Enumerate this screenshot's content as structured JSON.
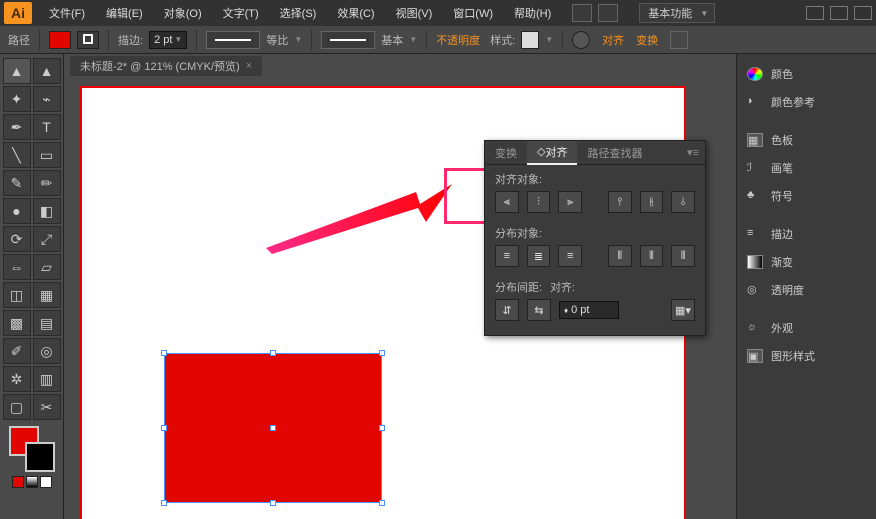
{
  "app": {
    "logo": "Ai"
  },
  "menu": [
    "文件(F)",
    "编辑(E)",
    "对象(O)",
    "文字(T)",
    "选择(S)",
    "效果(C)",
    "视图(V)",
    "窗口(W)",
    "帮助(H)"
  ],
  "top_dropdown": "基本功能",
  "control": {
    "path_label": "路径",
    "fill_color": "#e10600",
    "stroke_color": "#000000",
    "stroke_label": "描边:",
    "stroke_value": "2 pt",
    "profile": "等比",
    "brush": "基本",
    "opacity_label": "不透明度",
    "style_label": "样式:",
    "align_label": "对齐",
    "transform_label": "变换"
  },
  "doc_tab": {
    "title": "未标题-2* @ 121% (CMYK/预览)"
  },
  "align_panel": {
    "tabs": [
      "变换",
      "对齐",
      "路径查找器"
    ],
    "active_tab": 1,
    "sec1": "对齐对象:",
    "sec2": "分布对象:",
    "sec3": "分布间距:",
    "align_right_label": "对齐:",
    "gap_value": "0 pt"
  },
  "right_panels": {
    "group1": [
      "颜色",
      "颜色参考"
    ],
    "group2": [
      "色板",
      "画笔",
      "符号"
    ],
    "group3": [
      "描边",
      "渐变",
      "透明度"
    ],
    "group4": [
      "外观",
      "图形样式"
    ]
  }
}
